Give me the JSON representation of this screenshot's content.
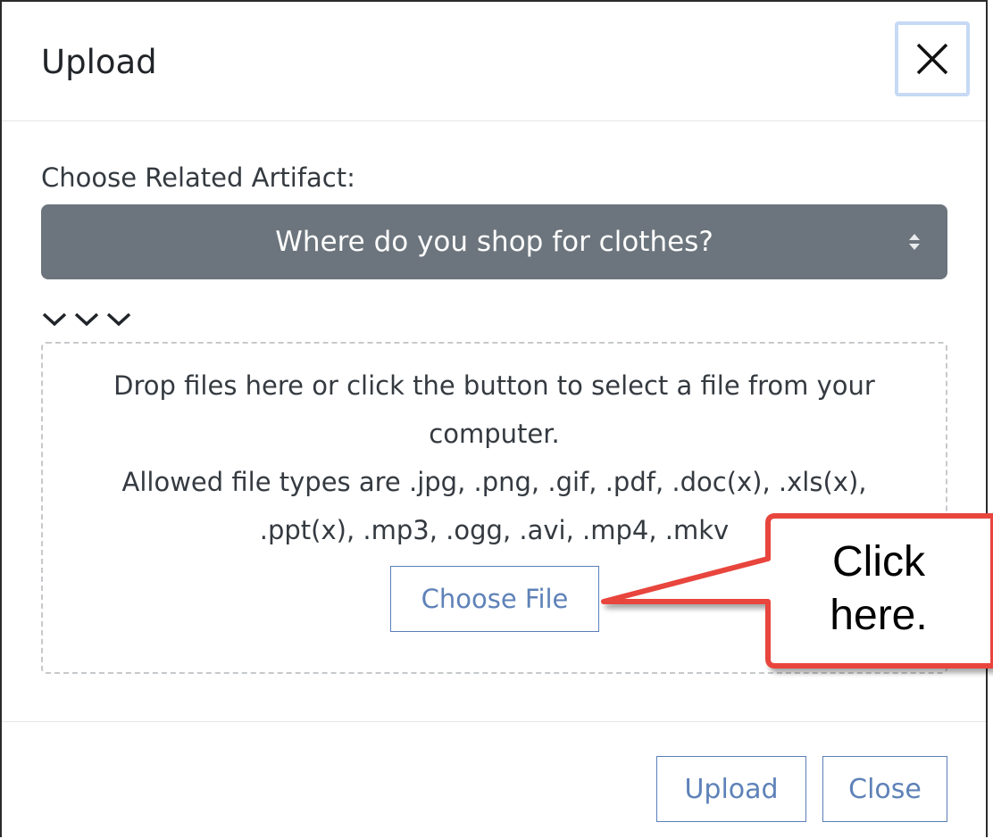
{
  "dialog": {
    "title": "Upload",
    "close_icon": "close-icon"
  },
  "form": {
    "artifact_label": "Choose Related Artifact:",
    "artifact_selected": "Where do you shop for clothes?",
    "select_icon": "sort-arrows-icon",
    "toggle_icon": "chevron-down-icon"
  },
  "dropzone": {
    "line1": "Drop files here or click the button to select a file from your computer.",
    "line2": "Allowed file types are .jpg, .png, .gif, .pdf, .doc(x), .xls(x), .ppt(x), .mp3, .ogg, .avi, .mp4, .mkv",
    "choose_file_label": "Choose File"
  },
  "footer": {
    "upload_label": "Upload",
    "close_label": "Close"
  },
  "callout": {
    "line1": "Click",
    "line2": "here.",
    "colors": {
      "border": "#e8453c",
      "fill": "#ffffff"
    }
  },
  "colors": {
    "select_bg": "#6c757d",
    "button_border": "#5b7fb8",
    "button_text": "#5e82b8",
    "close_focus": "#c6d9f5"
  }
}
